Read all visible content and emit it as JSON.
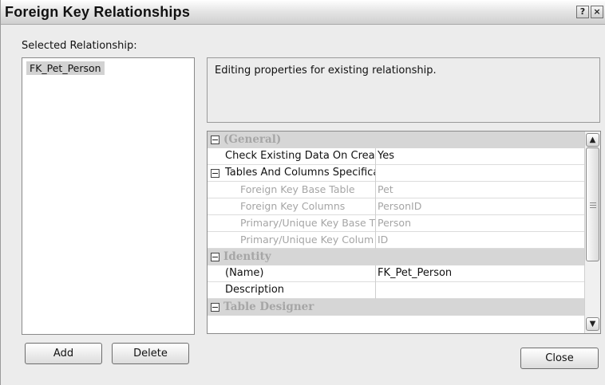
{
  "window": {
    "title": "Foreign Key Relationships",
    "help_label": "?",
    "close_label": "×"
  },
  "selected_relationship_label": "Selected Relationship:",
  "relationships": [
    "FK_Pet_Person"
  ],
  "description": "Editing properties for existing relationship.",
  "properties": [
    {
      "kind": "category",
      "name": "(General)"
    },
    {
      "kind": "property",
      "name": "Check Existing Data On Crea",
      "value": "Yes"
    },
    {
      "kind": "property",
      "name": "Tables And Columns Specifica",
      "value": "",
      "expandable": true
    },
    {
      "kind": "subproperty",
      "name": "Foreign Key Base Table",
      "value": "Pet"
    },
    {
      "kind": "subproperty",
      "name": "Foreign Key Columns",
      "value": "PersonID"
    },
    {
      "kind": "subproperty",
      "name": "Primary/Unique Key Base T",
      "value": "Person"
    },
    {
      "kind": "subproperty",
      "name": "Primary/Unique Key Colum",
      "value": "ID"
    },
    {
      "kind": "category",
      "name": "Identity"
    },
    {
      "kind": "property",
      "name": "(Name)",
      "value": "FK_Pet_Person"
    },
    {
      "kind": "property",
      "name": "Description",
      "value": ""
    },
    {
      "kind": "category",
      "name": "Table Designer"
    }
  ],
  "scrollbar": {
    "up_icon": "chevron-up-icon",
    "down_icon": "chevron-down-icon"
  },
  "buttons": {
    "add": "Add",
    "delete": "Delete",
    "close": "Close"
  }
}
